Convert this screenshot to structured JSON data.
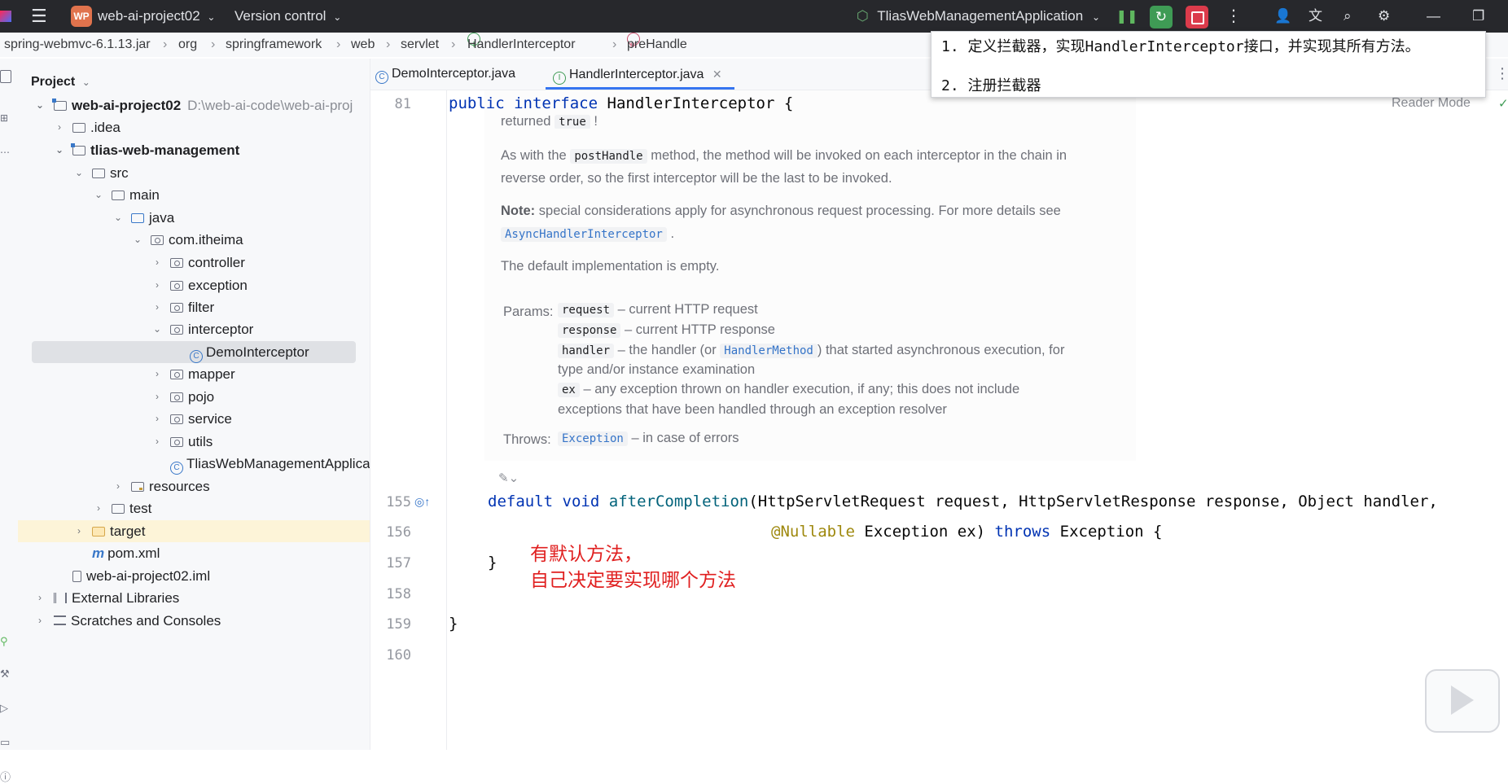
{
  "titlebar": {
    "project_badge": "WP",
    "project_name": "web-ai-project02",
    "version_control": "Version control",
    "run_config": "TliasWebManagementApplication"
  },
  "breadcrumb": [
    "spring-webmvc-6.1.13.jar",
    "org",
    "springframework",
    "web",
    "servlet",
    "HandlerInterceptor",
    "preHandle"
  ],
  "project_panel": {
    "title": "Project",
    "tree": [
      {
        "label": "web-ai-project02",
        "extra": "D:\\web-ai-code\\web-ai-proj"
      },
      {
        "label": ".idea"
      },
      {
        "label": "tlias-web-management"
      },
      {
        "label": "src"
      },
      {
        "label": "main"
      },
      {
        "label": "java"
      },
      {
        "label": "com.itheima"
      },
      {
        "label": "controller"
      },
      {
        "label": "exception"
      },
      {
        "label": "filter"
      },
      {
        "label": "interceptor"
      },
      {
        "label": "DemoInterceptor"
      },
      {
        "label": "mapper"
      },
      {
        "label": "pojo"
      },
      {
        "label": "service"
      },
      {
        "label": "utils"
      },
      {
        "label": "TliasWebManagementApplica"
      },
      {
        "label": "resources"
      },
      {
        "label": "test"
      },
      {
        "label": "target"
      },
      {
        "label": "pom.xml"
      },
      {
        "label": "web-ai-project02.iml"
      },
      {
        "label": "External Libraries"
      },
      {
        "label": "Scratches and Consoles"
      }
    ]
  },
  "tabs": [
    {
      "label": "DemoInterceptor.java"
    },
    {
      "label": "HandlerInterceptor.java"
    }
  ],
  "editor": {
    "reader_mode": "Reader Mode",
    "line_numbers": [
      "81",
      "155",
      "156",
      "157",
      "158",
      "159",
      "160"
    ],
    "line81": {
      "kw1": "public",
      "kw2": "interface",
      "name": "HandlerInterceptor",
      "brace": "{"
    },
    "doc": {
      "returned_prefix": "returned",
      "returned_code": "true",
      "p1_a": "As with the",
      "p1_code": "postHandle",
      "p1_b": "method, the method will be invoked on each interceptor in the chain in",
      "p1_c": "reverse order, so the first interceptor will be the last to be invoked.",
      "note_label": "Note:",
      "note_a": "special considerations apply for asynchronous request processing. For more details see",
      "note_code": "AsyncHandlerInterceptor",
      "default_impl": "The default implementation is empty.",
      "params_label": "Params:",
      "p_request": "request",
      "p_request_desc": "– current HTTP request",
      "p_response": "response",
      "p_response_desc": "– current HTTP response",
      "p_handler": "handler",
      "p_handler_a": "– the handler (or",
      "p_handler_code": "HandlerMethod",
      "p_handler_b": ") that started asynchronous execution, for",
      "p_handler_c": "type and/or instance examination",
      "p_ex": "ex",
      "p_ex_a": "– any exception thrown on handler execution, if any; this does not include",
      "p_ex_b": "exceptions that have been handled through an exception resolver",
      "throws_label": "Throws:",
      "throws_code": "Exception",
      "throws_desc": "– in case of errors"
    },
    "line155": {
      "kw1": "default",
      "kw2": "void",
      "fn": "afterCompletion",
      "rest": "(HttpServletRequest request, HttpServletResponse response, Object handler,"
    },
    "line156": {
      "ann": "@Nullable",
      "a": " Exception ex) ",
      "kw": "throws",
      "b": " Exception {"
    },
    "line157": "}",
    "line159": "}"
  },
  "tooltip": {
    "line1": "1. 定义拦截器，实现HandlerInterceptor接口，并实现其所有方法。",
    "line2": "2. 注册拦截器"
  },
  "annotation": {
    "line1": "有默认方法，",
    "line2": "自己决定要实现哪个方法"
  },
  "colors": {
    "accent": "#3574f0",
    "annotation_red": "#e02020",
    "titlebar_bg": "#27282c"
  }
}
